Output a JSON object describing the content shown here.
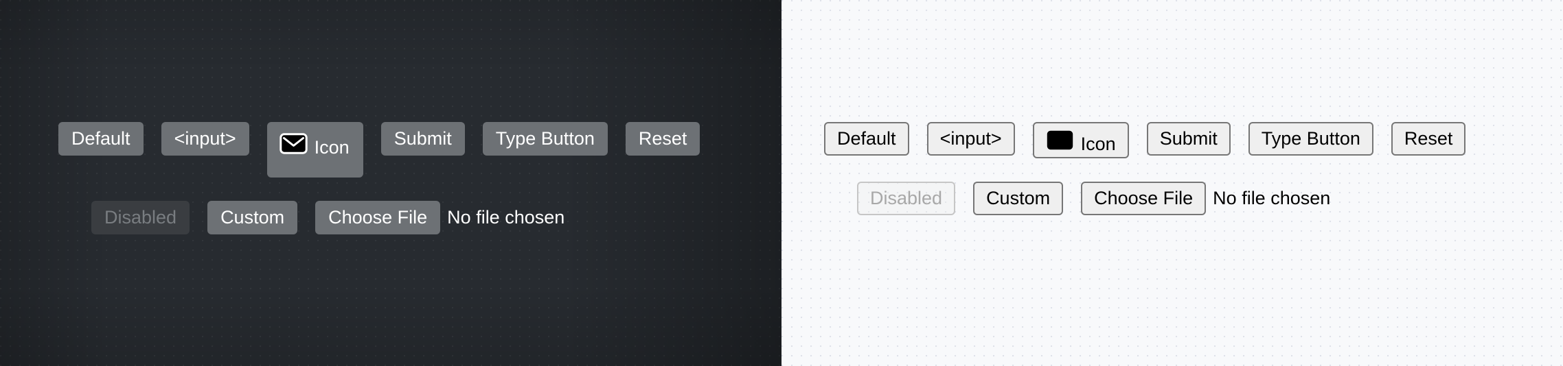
{
  "panels": [
    {
      "theme": "dark",
      "background_color": "#272b30",
      "button_fill": "#6d7175",
      "text_color": "#ffffff",
      "disabled_fill": "#3a3d41",
      "disabled_text": "#797d81",
      "row1": {
        "default_label": "Default",
        "input_label": "<input>",
        "icon_label": "Icon",
        "icon_name": "envelope-icon",
        "submit_label": "Submit",
        "type_button_label": "Type Button",
        "reset_label": "Reset"
      },
      "row2": {
        "disabled_label": "Disabled",
        "custom_label": "Custom",
        "choose_file_label": "Choose File",
        "file_status": "No file chosen"
      }
    },
    {
      "theme": "light",
      "background_color": "#f8f9fb",
      "button_fill": "#efefef",
      "button_border": "#767676",
      "text_color": "#000000",
      "disabled_text": "#a8a8a8",
      "row1": {
        "default_label": "Default",
        "input_label": "<input>",
        "icon_label": "Icon",
        "icon_name": "envelope-icon",
        "submit_label": "Submit",
        "type_button_label": "Type Button",
        "reset_label": "Reset"
      },
      "row2": {
        "disabled_label": "Disabled",
        "custom_label": "Custom",
        "choose_file_label": "Choose File",
        "file_status": "No file chosen"
      }
    }
  ]
}
